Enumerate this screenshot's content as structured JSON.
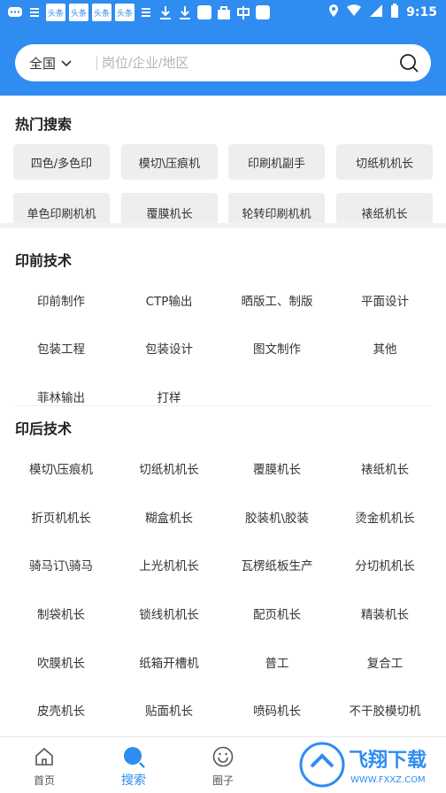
{
  "status_bar": {
    "time": "9:15",
    "badges": [
      "头条",
      "头条",
      "头条",
      "头条"
    ]
  },
  "search": {
    "region": "全国",
    "placeholder": "岗位/企业/地区"
  },
  "hot_search": {
    "title": "热门搜索",
    "items": [
      "四色/多色印",
      "模切\\压痕机",
      "印刷机副手",
      "切纸机机长",
      "单色印刷机机",
      "覆膜机长",
      "轮转印刷机机",
      "裱纸机长"
    ]
  },
  "prepress": {
    "title": "印前技术",
    "items": [
      "印前制作",
      "CTP输出",
      "晒版工、制版",
      "平面设计",
      "包装工程",
      "包装设计",
      "图文制作",
      "其他",
      "菲林输出",
      "打样"
    ]
  },
  "postpress": {
    "title": "印后技术",
    "items": [
      "模切\\压痕机",
      "切纸机机长",
      "覆膜机长",
      "裱纸机长",
      "折页机机长",
      "糊盒机长",
      "胶装机\\胶装",
      "烫金机机长",
      "骑马订\\骑马",
      "上光机机长",
      "瓦楞纸板生产",
      "分切机机长",
      "制袋机长",
      "锁线机机长",
      "配页机长",
      "精装机长",
      "吹膜机长",
      "纸箱开槽机",
      "普工",
      "复合工",
      "皮壳机长",
      "贴面机长",
      "喷码机长",
      "不干胶模切机"
    ]
  },
  "nav": {
    "home": "首页",
    "search": "搜索",
    "circle": "圈子"
  },
  "watermark": {
    "text": "飞翔下载",
    "url": "WWW.FXXZ.COM"
  },
  "colors": {
    "primary": "#2f8cf0",
    "chip_bg": "#eeeeee"
  }
}
